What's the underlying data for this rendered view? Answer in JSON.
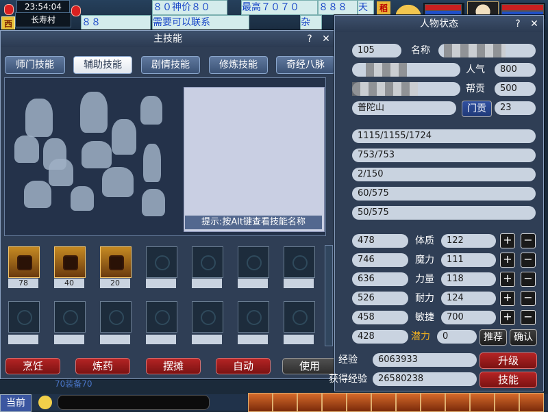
{
  "hud": {
    "time": "23:54:04",
    "location": "长寿村",
    "direction": "西",
    "gold_badge": "稻",
    "ticker": [
      "８０神价８０",
      "最高７０７０",
      "８８８",
      "天",
      "８８",
      "需要可以联系",
      "杂",
      "888",
      "需要"
    ],
    "ticker_bottom": "70装备70",
    "current_channel": "当前"
  },
  "skills_window": {
    "title": "主技能",
    "tabs": [
      "师门技能",
      "辅助技能",
      "剧情技能",
      "修炼技能",
      "奇经八脉"
    ],
    "active_tab": 1,
    "hint": "提示:按Alt键查看技能名称",
    "slot_levels": [
      "78",
      "40",
      "20"
    ],
    "buttons": [
      "烹饪",
      "炼药",
      "摆摊",
      "自动",
      "使用"
    ]
  },
  "status_window": {
    "title": "人物状态",
    "level_value": "105",
    "name_label": "名称",
    "popularity_label": "人气",
    "popularity_value": "800",
    "guild_contrib_label": "帮贡",
    "guild_contrib_value": "500",
    "school_value": "普陀山",
    "school_contrib_label": "门贡",
    "school_contrib_value": "23",
    "hp": "1115/1155/1724",
    "mp": "753/753",
    "anger": "2/150",
    "vigor": "60/575",
    "stamina": "50/575",
    "combat_values": [
      "478",
      "746",
      "636",
      "526",
      "458",
      "428"
    ],
    "attributes": [
      {
        "label": "体质",
        "value": "122"
      },
      {
        "label": "魔力",
        "value": "111"
      },
      {
        "label": "力量",
        "value": "118"
      },
      {
        "label": "耐力",
        "value": "124"
      },
      {
        "label": "敏捷",
        "value": "700"
      }
    ],
    "potential_label": "潜力",
    "potential_value": "0",
    "recommend_label": "推荐",
    "confirm_label": "确认",
    "levelup_exp_label": "经验",
    "levelup_exp_value": "6063933",
    "obtained_exp_label": "获得经验",
    "obtained_exp_value": "26580238",
    "levelup_button": "升级",
    "skills_button": "技能",
    "plus": "+",
    "minus": "−",
    "help": "?",
    "close": "✕"
  },
  "colors": {
    "potential": "#f0b020",
    "red_button": "#9a1a1a",
    "tab_active": "#ffffff"
  }
}
